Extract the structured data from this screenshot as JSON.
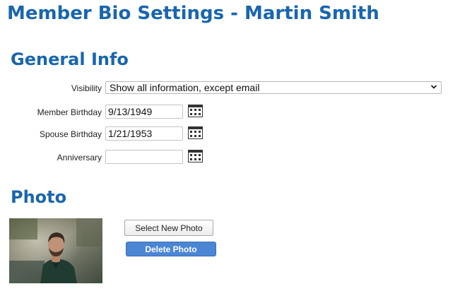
{
  "page": {
    "title": "Member Bio Settings - Martin Smith"
  },
  "general_info": {
    "heading": "General Info",
    "visibility": {
      "label": "Visibility",
      "selected": "Show all information, except email"
    },
    "member_birthday": {
      "label": "Member Birthday",
      "value": "9/13/1949"
    },
    "spouse_birthday": {
      "label": "Spouse Birthday",
      "value": "1/21/1953"
    },
    "anniversary": {
      "label": "Anniversary",
      "value": ""
    }
  },
  "photo": {
    "heading": "Photo",
    "select_label": "Select New Photo",
    "delete_label": "Delete Photo"
  },
  "colors": {
    "heading": "#1a66ad",
    "delete_button": "#4a86d4"
  },
  "icons": {
    "date_picker": "calendar-icon",
    "dropdown": "chevron-down-icon"
  }
}
